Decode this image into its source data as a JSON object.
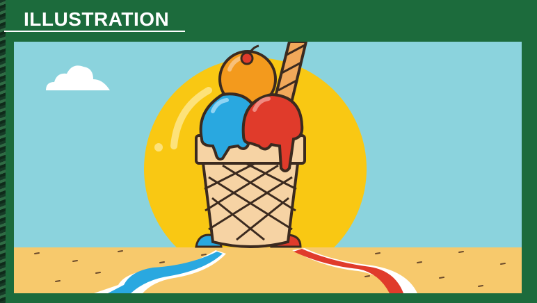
{
  "header": {
    "title": "ILLUSTRATION"
  },
  "illustration": {
    "subject": "ice-cream-cone",
    "colors": {
      "background": "#1c6b3c",
      "sky": "#8bd3dd",
      "sun": "#f9c813",
      "sand": "#f7c96c",
      "blue_scoop": "#29a8e0",
      "red_scoop": "#e03b2b",
      "orange_scoop": "#f39a1d",
      "cone": "#f6d3a4",
      "outline": "#3b2a1f"
    }
  }
}
